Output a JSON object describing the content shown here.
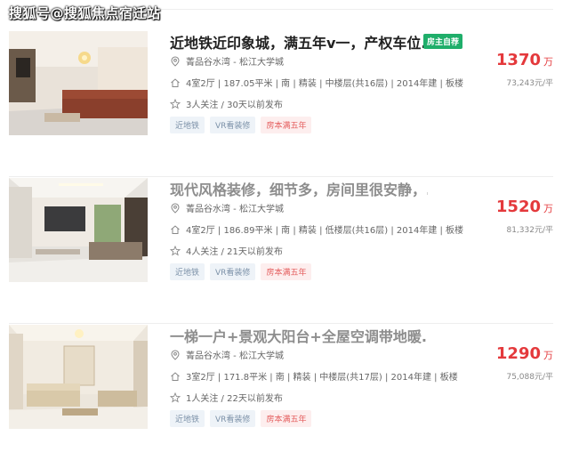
{
  "watermark": "搜狐号@搜狐焦点宿迁站",
  "listings": [
    {
      "title": "近地铁近印象城，满五年v一，产权车位...",
      "badge": "房主自荐",
      "location": "菁品谷水湾 - 松江大学城",
      "details": "4室2厅 | 187.05平米 | 南 | 精装 | 中楼层(共16层) | 2014年建 | 板楼",
      "follow": "3人关注 / 30天以前发布",
      "tags": [
        "近地铁",
        "VR看装修",
        "房本满五年"
      ],
      "price": "1370",
      "price_unit": "万",
      "unit_price": "73,243元/平"
    },
    {
      "title": "现代风格装修，细节多，房间里很安静，...",
      "location": "菁品谷水湾 - 松江大学城",
      "details": "4室2厅 | 186.89平米 | 南 | 精装 | 低楼层(共16层) | 2014年建 | 板楼",
      "follow": "4人关注 / 21天以前发布",
      "tags": [
        "近地铁",
        "VR看装修",
        "房本满五年"
      ],
      "price": "1520",
      "price_unit": "万",
      "unit_price": "81,332元/平"
    },
    {
      "title": "一梯一户+景观大阳台+全屋空调带地暖...",
      "location": "菁品谷水湾 - 松江大学城",
      "details": "3室2厅 | 171.8平米 | 南 | 精装 | 中楼层(共17层) | 2014年建 | 板楼",
      "follow": "1人关注 / 22天以前发布",
      "tags": [
        "近地铁",
        "VR看装修",
        "房本满五年"
      ],
      "price": "1290",
      "price_unit": "万",
      "unit_price": "75,088元/平"
    }
  ]
}
